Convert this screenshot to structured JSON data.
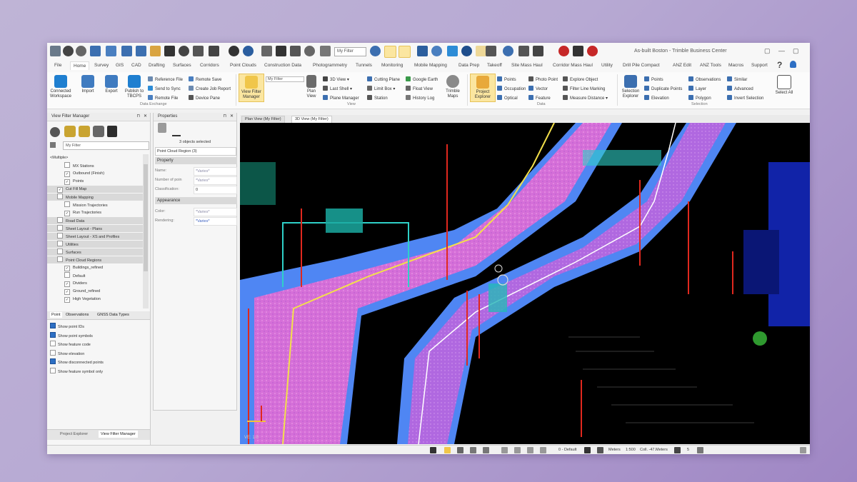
{
  "window": {
    "title": "As-built Boston - Trimble Business Center",
    "quick_filter": "My Filter"
  },
  "menu_tabs": [
    "File",
    "Home",
    "Survey",
    "GIS",
    "CAD",
    "Drafting",
    "Surfaces",
    "Corridors",
    "Point Clouds",
    "Construction Data",
    "Photogrammetry",
    "Tunnels",
    "Monitoring",
    "Mobile Mapping",
    "Data Prep",
    "Takeoff",
    "Site Mass Haul",
    "Corridor Mass Haul",
    "Utility",
    "Drill Pile Compact",
    "ANZ Edit",
    "ANZ Tools",
    "Macros",
    "Support"
  ],
  "ribbon": {
    "data_exchange": {
      "big": [
        "Connected Workspace",
        "Import",
        "Export",
        "Publish to TBCPS"
      ],
      "small": [
        "Reference File",
        "Send to Sync",
        "Remote File",
        "Remote Save",
        "Create Job Report",
        "Device Pane"
      ],
      "group_label": "Data Exchange"
    },
    "view": {
      "big": [
        "View Filter Manager",
        "Plan View",
        "Trimble Maps"
      ],
      "filter_value": "My Filter",
      "small": [
        "3D View",
        "Last Shell",
        "Plane Manager",
        "Cutting Plane",
        "Limit Box",
        "Station",
        "Google Earth",
        "Float View",
        "History Log"
      ],
      "group_label": "View"
    },
    "data": {
      "big": [
        "Project Explorer"
      ],
      "small": [
        "Points",
        "Occupation",
        "Optical",
        "Photo Point",
        "Vector",
        "Feature",
        "Explore Object",
        "Filter Line Marking",
        "Measure Distance"
      ],
      "group_label": "Data"
    },
    "selection": {
      "big": [
        "Selection Explorer",
        "Select All"
      ],
      "small": [
        "Points",
        "Duplicate Points",
        "Elevation",
        "Observations",
        "Layer",
        "Polygon",
        "Similar",
        "Advanced",
        "Invert Selection"
      ],
      "group_label": "Selection"
    }
  },
  "view_filter_manager": {
    "title": "View Filter Manager",
    "filter": "My Filter",
    "tree": [
      {
        "label": "<Multiple>",
        "level": 0,
        "checked": false,
        "grey": false
      },
      {
        "label": "MX Stations",
        "level": 2,
        "checked": false,
        "grey": false
      },
      {
        "label": "Outbound (Finish)",
        "level": 2,
        "checked": true,
        "grey": false
      },
      {
        "label": "Points",
        "level": 2,
        "checked": true,
        "grey": false
      },
      {
        "label": "Cut Fill Map",
        "level": 1,
        "checked": true,
        "grey": true
      },
      {
        "label": "Mobile Mapping",
        "level": 1,
        "checked": false,
        "grey": true
      },
      {
        "label": "Mission Trajectories",
        "level": 2,
        "checked": false,
        "grey": false
      },
      {
        "label": "Run Trajectories",
        "level": 2,
        "checked": true,
        "grey": false
      },
      {
        "label": "Road Data",
        "level": 1,
        "checked": false,
        "grey": true
      },
      {
        "label": "Sheet Layout - Plans",
        "level": 1,
        "checked": false,
        "grey": true
      },
      {
        "label": "Sheet Layout - XS and Profiles",
        "level": 1,
        "checked": false,
        "grey": true
      },
      {
        "label": "Utilities",
        "level": 1,
        "checked": false,
        "grey": true
      },
      {
        "label": "Surfaces",
        "level": 1,
        "checked": false,
        "grey": true
      },
      {
        "label": "Point Cloud Regions",
        "level": 1,
        "checked": false,
        "grey": true
      },
      {
        "label": "Buildings_refined",
        "level": 2,
        "checked": true,
        "grey": false
      },
      {
        "label": "Default",
        "level": 2,
        "checked": false,
        "grey": false
      },
      {
        "label": "Dividers",
        "level": 2,
        "checked": true,
        "grey": false
      },
      {
        "label": "Ground_refined",
        "level": 2,
        "checked": true,
        "grey": false
      },
      {
        "label": "High Vegetation",
        "level": 2,
        "checked": true,
        "grey": false
      }
    ],
    "bottom_tabs": [
      "Point",
      "Observations",
      "GNSS Data Types"
    ],
    "options": [
      {
        "label": "Show point IDs",
        "checked": true
      },
      {
        "label": "Show point symbols",
        "checked": true
      },
      {
        "label": "Show feature code",
        "checked": false
      },
      {
        "label": "Show elevation",
        "checked": false
      },
      {
        "label": "Show disconnected points",
        "checked": true
      },
      {
        "label": "Show feature symbol only",
        "checked": false
      }
    ],
    "footer_tabs": [
      "Project Explorer",
      "View Filter Manager"
    ]
  },
  "properties": {
    "title": "Properties",
    "selected_text": "3 objects selected",
    "object_type": "Point Cloud Region (3)",
    "sections": {
      "property": "Property",
      "appearance": "Appearance"
    },
    "rows": [
      {
        "label": "Name:",
        "value": "*Varies*"
      },
      {
        "label": "Number of poin",
        "value": "*Varies*"
      },
      {
        "label": "Classification:",
        "value": "0"
      }
    ],
    "appearance_rows": [
      {
        "label": "Color:",
        "value": "*Varies*"
      },
      {
        "label": "Rendering:",
        "value": "*Varies*"
      }
    ]
  },
  "viewport": {
    "tabs": [
      "Plan View (My Filter)",
      "3D View (My Filter)"
    ],
    "active_tab": 1,
    "scale_label": "VE: 1.0"
  },
  "status": {
    "layer": "0 - Default",
    "units": "Meters",
    "scale": "1:500",
    "coord": "Coll. -47.Meters",
    "page": "5"
  },
  "colors": {
    "accent": "#2d6fc4",
    "highlight": "#fbe6a0",
    "road_pink": "#e97ee0",
    "road_purple": "#a55bd6",
    "road_edge": "#5a8ff0",
    "point_red": "#e0281e",
    "cyan": "#35d6d0"
  }
}
